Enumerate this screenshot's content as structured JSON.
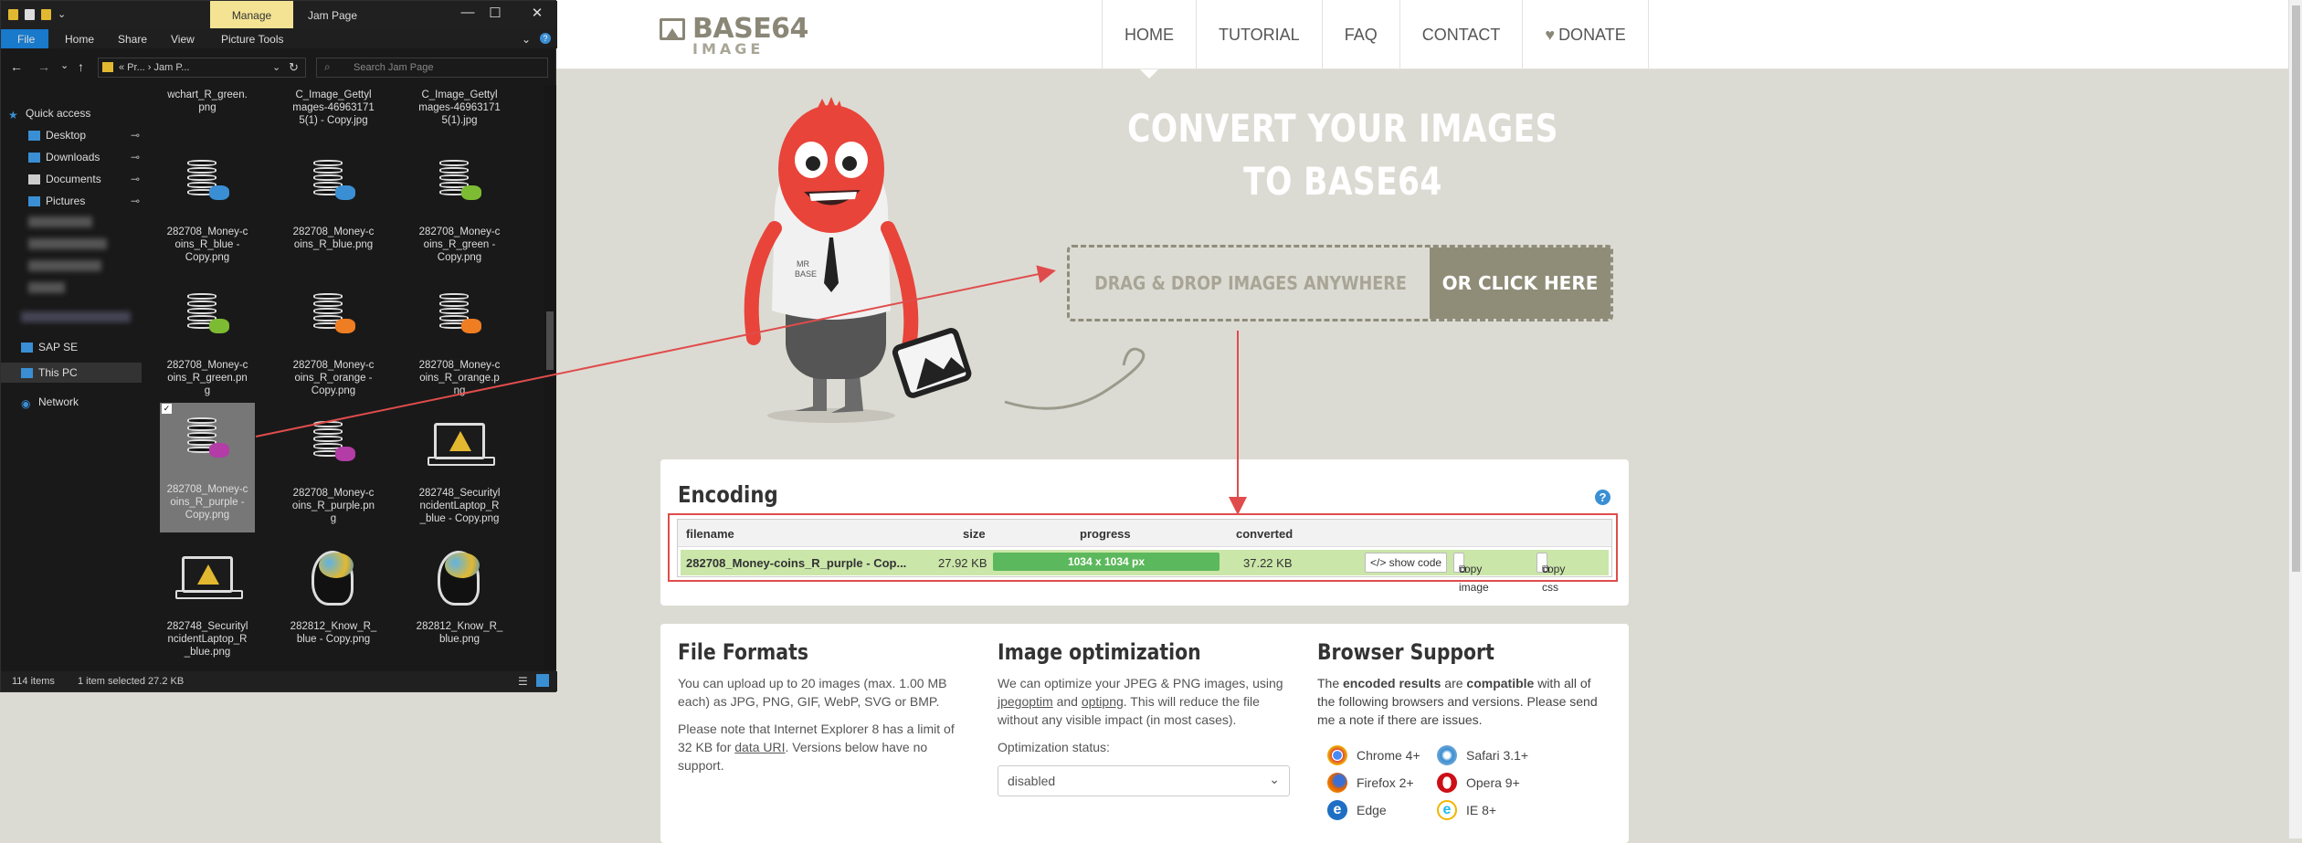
{
  "website": {
    "logo": {
      "main": "BASE64",
      "sub": "IMAGE"
    },
    "nav": [
      {
        "label": "HOME"
      },
      {
        "label": "TUTORIAL"
      },
      {
        "label": "FAQ"
      },
      {
        "label": "CONTACT"
      },
      {
        "label": "DONATE"
      }
    ],
    "hero": {
      "title_line1": "CONVERT YOUR IMAGES",
      "title_line2": "TO BASE64",
      "drop_text": "DRAG & DROP IMAGES ANYWHERE",
      "click_text": "OR CLICK HERE",
      "mascot_shirt": "MR\nBASE"
    },
    "encoding": {
      "title": "Encoding",
      "help": "?",
      "headers": {
        "filename": "filename",
        "size": "size",
        "progress": "progress",
        "converted": "converted"
      },
      "row": {
        "filename": "282708_Money-coins_R_purple - Cop...",
        "size": "27.92 KB",
        "progress": "1034 x 1034 px",
        "progress_fraction": 1.0,
        "converted": "37.22 KB",
        "show_code": "</> show code",
        "copy_image": "copy image",
        "copy_css": "copy css"
      }
    },
    "file_formats": {
      "title": "File Formats",
      "p1": "You can upload up to 20 images (max. 1.00 MB each) as JPG, PNG, GIF, WebP, SVG or BMP.",
      "p2_pre": "Please note that Internet Explorer 8 has a limit of 32 KB for ",
      "p2_link": "data URI",
      "p2_post": ". Versions below have no support."
    },
    "image_optimization": {
      "title": "Image optimization",
      "p_pre": "We can optimize your JPEG & PNG images, using ",
      "link1": "jpegoptim",
      "p_mid": " and ",
      "link2": "optipng",
      "p_post": ". This will reduce the file without any visible impact (in most cases).",
      "status_label": "Optimization status:",
      "status_value": "disabled"
    },
    "browser_support": {
      "title": "Browser Support",
      "p_pre": "The ",
      "b1": "encoded results",
      "p_mid": " are ",
      "b2": "compatible",
      "p_post": " with all of the following browsers and versions. Please send me a note if there are issues.",
      "browsers": [
        {
          "name": "Chrome 4+",
          "icon": "chrome-icon",
          "color": "#dd4b39"
        },
        {
          "name": "Safari 3.1+",
          "icon": "safari-icon",
          "color": "#3a8fd4"
        },
        {
          "name": "Firefox 2+",
          "icon": "firefox-icon",
          "color": "#e66000"
        },
        {
          "name": "Opera 9+",
          "icon": "opera-icon",
          "color": "#cc0f16"
        },
        {
          "name": "Edge",
          "icon": "edge-icon",
          "color": "#1e6fc4"
        },
        {
          "name": "IE 8+",
          "icon": "ie-icon",
          "color": "#1ebbee"
        }
      ]
    }
  },
  "explorer": {
    "manage_tab": "Manage",
    "window_title": "Jam Page",
    "ribbon": [
      "File",
      "Home",
      "Share",
      "View",
      "Picture Tools"
    ],
    "address": "«  Pr...  ›  Jam P...",
    "search_placeholder": "Search Jam Page",
    "nav_pane": [
      {
        "label": "Quick access"
      },
      {
        "label": "Desktop"
      },
      {
        "label": "Downloads"
      },
      {
        "label": "Documents"
      },
      {
        "label": "Pictures"
      },
      {
        "label": "SAP SE"
      },
      {
        "label": "This PC"
      },
      {
        "label": "Network"
      }
    ],
    "files": [
      {
        "name": "wchart_R_green.\npng",
        "kind": "partial"
      },
      {
        "name": "C_Image_Gettyl\nmages-46963171\n5(1) - Copy.jpg",
        "kind": "partial"
      },
      {
        "name": "C_Image_Gettyl\nmages-46963171\n5(1).jpg",
        "kind": "partial"
      },
      {
        "name": "282708_Money-c\noins_R_blue -\nCopy.png",
        "kind": "coins",
        "color": "#3a8fd4"
      },
      {
        "name": "282708_Money-c\noins_R_blue.png",
        "kind": "coins",
        "color": "#3a8fd4"
      },
      {
        "name": "282708_Money-c\noins_R_green -\nCopy.png",
        "kind": "coins",
        "color": "#7dbb32"
      },
      {
        "name": "282708_Money-c\noins_R_green.pn\ng",
        "kind": "coins",
        "color": "#7dbb32"
      },
      {
        "name": "282708_Money-c\noins_R_orange -\nCopy.png",
        "kind": "coins",
        "color": "#ef7d22"
      },
      {
        "name": "282708_Money-c\noins_R_orange.p\nng",
        "kind": "coins",
        "color": "#ef7d22"
      },
      {
        "name": "282708_Money-c\noins_R_purple -\nCopy.png",
        "kind": "coins",
        "color": "#b33ca6",
        "selected": true
      },
      {
        "name": "282708_Money-c\noins_R_purple.pn\ng",
        "kind": "coins",
        "color": "#b33ca6"
      },
      {
        "name": "282748_Securityl\nncidentLaptop_R\n_blue - Copy.png",
        "kind": "laptop"
      },
      {
        "name": "282748_Securityl\nncidentLaptop_R\n_blue.png",
        "kind": "laptop"
      },
      {
        "name": "282812_Know_R_\nblue - Copy.png",
        "kind": "head"
      },
      {
        "name": "282812_Know_R_\nblue.png",
        "kind": "head"
      }
    ],
    "status": {
      "count": "114 items",
      "selected": "1 item selected  27.2 KB"
    }
  }
}
